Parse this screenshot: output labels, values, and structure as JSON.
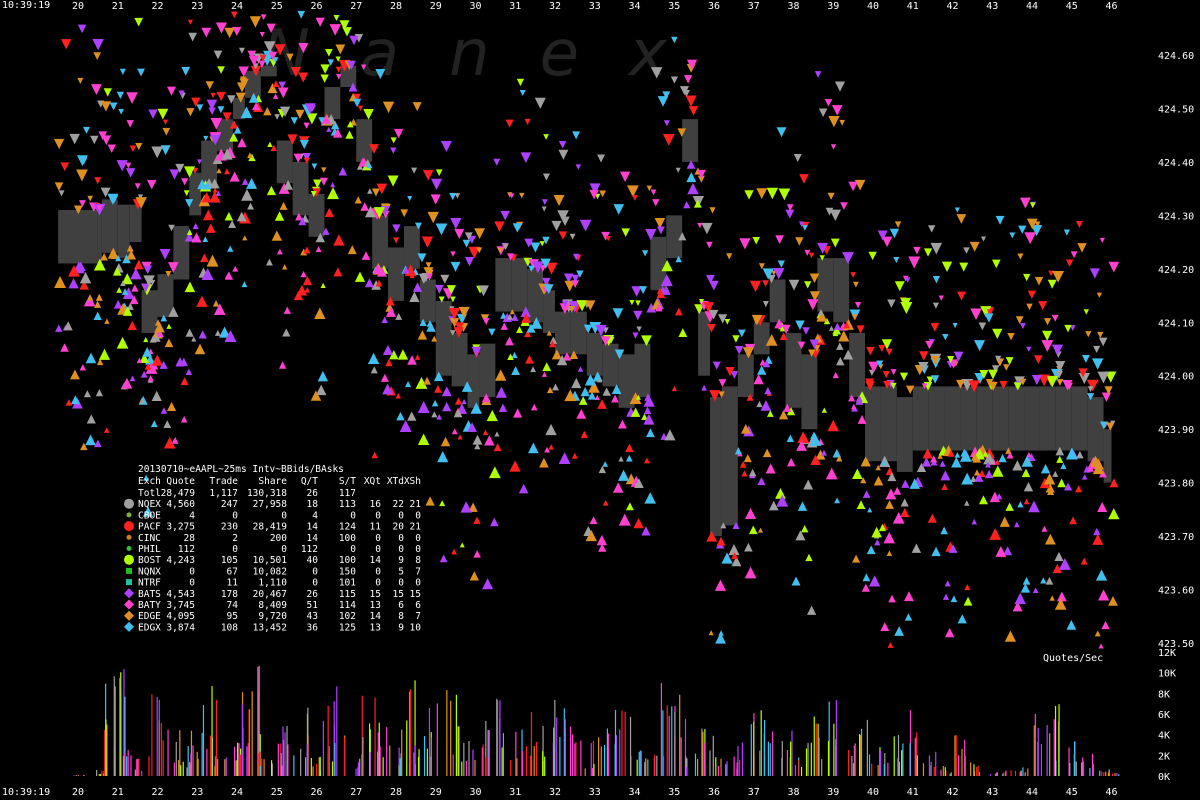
{
  "watermark": "Nanex",
  "header_time": "10:39:19",
  "footer_time": "10:39:19",
  "volume_label": "Quotes/Sec",
  "stats_title": "20130710~eAAPL~25ms Intv~BBids/BAsks",
  "stats_header": [
    "Exch",
    "Quote",
    "Trade",
    "Share",
    "Q/T",
    "S/T",
    "XQt",
    "XTd",
    "XSh"
  ],
  "stats_rows": [
    {
      "exch": "Totl",
      "quote": "28,479",
      "trade": "1,117",
      "share": "130,318",
      "qt": "26",
      "st": "117",
      "xqt": "",
      "xtd": "",
      "xsh": "",
      "color": "",
      "marker": "none"
    },
    {
      "exch": "NQEX",
      "quote": "4,560",
      "trade": "247",
      "share": "27,958",
      "qt": "18",
      "st": "113",
      "xqt": "16",
      "xtd": "22",
      "xsh": "21",
      "color": "#a0a0a0",
      "marker": "circle"
    },
    {
      "exch": "CBOE",
      "quote": "4",
      "trade": "0",
      "share": "0",
      "qt": "4",
      "st": "0",
      "xqt": "0",
      "xtd": "0",
      "xsh": "0",
      "color": "#80b040",
      "marker": "small-circle"
    },
    {
      "exch": "PACF",
      "quote": "3,275",
      "trade": "230",
      "share": "28,419",
      "qt": "14",
      "st": "124",
      "xqt": "11",
      "xtd": "20",
      "xsh": "21",
      "color": "#ff2020",
      "marker": "circle"
    },
    {
      "exch": "CINC",
      "quote": "28",
      "trade": "2",
      "share": "200",
      "qt": "14",
      "st": "100",
      "xqt": "0",
      "xtd": "0",
      "xsh": "0",
      "color": "#d08020",
      "marker": "small-circle"
    },
    {
      "exch": "PHIL",
      "quote": "112",
      "trade": "0",
      "share": "0",
      "qt": "112",
      "st": "0",
      "xqt": "0",
      "xtd": "0",
      "xsh": "0",
      "color": "#30c030",
      "marker": "small-circle"
    },
    {
      "exch": "BOST",
      "quote": "4,243",
      "trade": "105",
      "share": "10,501",
      "qt": "40",
      "st": "100",
      "xqt": "14",
      "xtd": "9",
      "xsh": "8",
      "color": "#b0ff00",
      "marker": "circle"
    },
    {
      "exch": "NQNX",
      "quote": "0",
      "trade": "67",
      "share": "10,082",
      "qt": "0",
      "st": "150",
      "xqt": "0",
      "xtd": "5",
      "xsh": "7",
      "color": "#20c020",
      "marker": "square"
    },
    {
      "exch": "NTRF",
      "quote": "0",
      "trade": "11",
      "share": "1,110",
      "qt": "0",
      "st": "101",
      "xqt": "0",
      "xtd": "0",
      "xsh": "0",
      "color": "#20c0a0",
      "marker": "square"
    },
    {
      "exch": "BATS",
      "quote": "4,543",
      "trade": "178",
      "share": "20,467",
      "qt": "26",
      "st": "115",
      "xqt": "15",
      "xtd": "15",
      "xsh": "15",
      "color": "#b040ff",
      "marker": "diamond"
    },
    {
      "exch": "BATY",
      "quote": "3,745",
      "trade": "74",
      "share": "8,409",
      "qt": "51",
      "st": "114",
      "xqt": "13",
      "xtd": "6",
      "xsh": "6",
      "color": "#ff40d0",
      "marker": "diamond"
    },
    {
      "exch": "EDGE",
      "quote": "4,095",
      "trade": "95",
      "share": "9,720",
      "qt": "43",
      "st": "102",
      "xqt": "14",
      "xtd": "8",
      "xsh": "7",
      "color": "#e09020",
      "marker": "diamond"
    },
    {
      "exch": "EDGX",
      "quote": "3,874",
      "trade": "108",
      "share": "13,452",
      "qt": "36",
      "st": "125",
      "xqt": "13",
      "xtd": "9",
      "xsh": "10",
      "color": "#40c0f0",
      "marker": "diamond"
    }
  ],
  "chart_data": {
    "type": "scatter",
    "title": "20130710~eAAPL~25ms Intv~BBids/BAsks",
    "x_ticks": [
      "20",
      "21",
      "22",
      "23",
      "24",
      "25",
      "26",
      "27",
      "28",
      "29",
      "30",
      "31",
      "32",
      "33",
      "34",
      "35",
      "36",
      "37",
      "38",
      "39",
      "40",
      "41",
      "42",
      "43",
      "44",
      "45",
      "46"
    ],
    "price_ylim": [
      423.5,
      424.68
    ],
    "price_ticks": [
      "424.60",
      "424.50",
      "424.40",
      "424.30",
      "424.20",
      "424.10",
      "424.00",
      "423.90",
      "423.80",
      "423.70",
      "423.60",
      "423.50"
    ],
    "volume_ylim": [
      0,
      12000
    ],
    "volume_ticks": [
      "12K",
      "10K",
      "8K",
      "6K",
      "4K",
      "2K",
      "0K"
    ],
    "series_colors": [
      "#a0a0a0",
      "#ff2020",
      "#b0ff00",
      "#b040ff",
      "#ff40d0",
      "#e09020",
      "#40c0f0"
    ],
    "nbbo": {
      "name": "NBBO spread",
      "color": "#404040",
      "x": [
        19.5,
        20.5,
        20.6,
        21.0,
        21.3,
        21.6,
        22.0,
        22.4,
        22.8,
        23.1,
        23.5,
        23.9,
        24.2,
        24.6,
        25.0,
        25.4,
        25.8,
        26.2,
        26.6,
        27.0,
        27.4,
        27.8,
        28.2,
        28.6,
        29.0,
        29.4,
        29.8,
        30.1,
        30.5,
        30.9,
        31.3,
        31.7,
        32.0,
        32.4,
        32.8,
        33.2,
        33.6,
        34.0,
        34.4,
        34.8,
        35.2,
        35.6,
        35.9,
        36.2,
        36.6,
        37.0,
        37.4,
        37.8,
        38.2,
        38.6,
        39.0,
        39.4,
        39.8,
        40.2,
        40.6,
        41.0,
        41.4,
        41.8,
        42.2,
        42.6,
        43.0,
        43.4,
        43.8,
        44.2,
        44.6,
        45.0,
        45.4,
        45.8,
        46.0
      ],
      "bid": [
        424.21,
        424.21,
        424.23,
        424.22,
        424.25,
        424.08,
        424.11,
        424.18,
        424.3,
        424.36,
        424.42,
        424.48,
        424.52,
        424.56,
        424.36,
        424.3,
        424.26,
        424.48,
        424.54,
        424.4,
        424.2,
        424.14,
        424.2,
        424.1,
        424.0,
        423.98,
        423.94,
        423.96,
        424.12,
        424.12,
        424.1,
        424.08,
        424.04,
        424.04,
        424.0,
        423.98,
        423.94,
        423.96,
        424.16,
        424.22,
        424.4,
        424.0,
        423.7,
        423.72,
        423.96,
        424.04,
        424.1,
        423.94,
        423.9,
        424.12,
        424.1,
        423.96,
        423.84,
        423.84,
        423.82,
        423.86,
        423.86,
        423.86,
        423.86,
        423.86,
        423.86,
        423.86,
        423.86,
        423.86,
        423.86,
        423.86,
        423.84,
        423.8,
        423.8
      ],
      "ask": [
        424.31,
        424.31,
        424.33,
        424.32,
        424.32,
        424.16,
        424.19,
        424.28,
        424.38,
        424.44,
        424.48,
        424.52,
        424.57,
        424.58,
        424.44,
        424.4,
        424.34,
        424.54,
        424.58,
        424.48,
        424.3,
        424.24,
        424.28,
        424.18,
        424.14,
        424.08,
        424.04,
        424.06,
        424.22,
        424.22,
        424.2,
        424.16,
        424.12,
        424.12,
        424.08,
        424.06,
        424.04,
        424.06,
        424.26,
        424.3,
        424.48,
        424.12,
        423.96,
        423.98,
        424.04,
        424.1,
        424.18,
        424.08,
        424.04,
        424.22,
        424.22,
        424.08,
        423.98,
        423.98,
        423.96,
        423.98,
        423.98,
        423.98,
        423.98,
        423.98,
        423.98,
        423.98,
        423.98,
        423.98,
        423.98,
        423.98,
        423.96,
        423.9,
        423.9
      ]
    },
    "quote_markers": "multi-colour bid (up-triangle) and ask (down-triangle) markers per exchange, colours as in legend",
    "volume_profile": {
      "name": "Quotes/Sec",
      "x": [
        20.0,
        20.5,
        20.8,
        21.0,
        21.3,
        21.6,
        22.0,
        22.4,
        22.8,
        23.0,
        23.3,
        23.6,
        24.0,
        24.2,
        24.4,
        24.7,
        25.0,
        25.3,
        25.6,
        26.0,
        26.3,
        26.6,
        27.0,
        27.3,
        27.6,
        28.0,
        28.3,
        28.6,
        29.0,
        29.4,
        29.8,
        30.2,
        30.6,
        31.0,
        31.4,
        31.8,
        32.1,
        32.4,
        32.8,
        33.2,
        33.6,
        34.0,
        34.4,
        34.8,
        35.1,
        35.4,
        35.8,
        36.2,
        36.6,
        37.0,
        37.4,
        37.8,
        38.2,
        38.6,
        39.0,
        39.4,
        39.8,
        40.2,
        40.6,
        41.0,
        41.4,
        41.8,
        42.2,
        42.6,
        43.0,
        43.4,
        43.8,
        44.2,
        44.6,
        45.0,
        45.4,
        45.8,
        46.0
      ],
      "values": [
        200,
        600,
        9000,
        10500,
        4000,
        2200,
        8000,
        4500,
        3000,
        6500,
        9000,
        2000,
        3500,
        9500,
        11000,
        3000,
        3500,
        5500,
        7000,
        2500,
        7000,
        9500,
        3000,
        8000,
        6500,
        5000,
        9500,
        4000,
        8500,
        9500,
        3500,
        6000,
        7500,
        4500,
        6500,
        5000,
        8500,
        9500,
        3500,
        5000,
        7000,
        6500,
        3000,
        9000,
        8000,
        2500,
        5500,
        2000,
        3500,
        7000,
        5500,
        4500,
        3500,
        6500,
        7500,
        4000,
        5500,
        3000,
        5500,
        6500,
        3000,
        1000,
        4000,
        1500,
        400,
        600,
        900,
        6500,
        7000,
        3500,
        2500,
        900,
        600
      ]
    }
  }
}
